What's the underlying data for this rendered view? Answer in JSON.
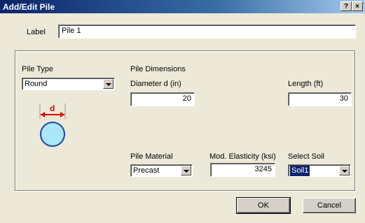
{
  "window": {
    "title": "Add/Edit Pile",
    "help_button": "?",
    "close_button": "×"
  },
  "label_field": {
    "label": "Label",
    "value": "Pile 1"
  },
  "pile_type": {
    "label": "Pile Type",
    "selected": "Round"
  },
  "pile_dimensions": {
    "heading": "Pile Dimensions",
    "diameter_label": "Diameter d (in)",
    "diameter_value": "20",
    "length_label": "Length (ft)",
    "length_value": "30"
  },
  "diagram": {
    "dimension_label": "d",
    "colors": {
      "arrow": "#e00000",
      "circle_fill": "#a8e8f8",
      "circle_stroke": "#1f3fb0"
    }
  },
  "pile_material": {
    "label": "Pile Material",
    "selected": "Precast"
  },
  "mod_elasticity": {
    "label": "Mod. Elasticity (ksi)",
    "value": "3245"
  },
  "select_soil": {
    "label": "Select Soil",
    "selected": "Soil1"
  },
  "buttons": {
    "ok": "OK",
    "cancel": "Cancel"
  }
}
